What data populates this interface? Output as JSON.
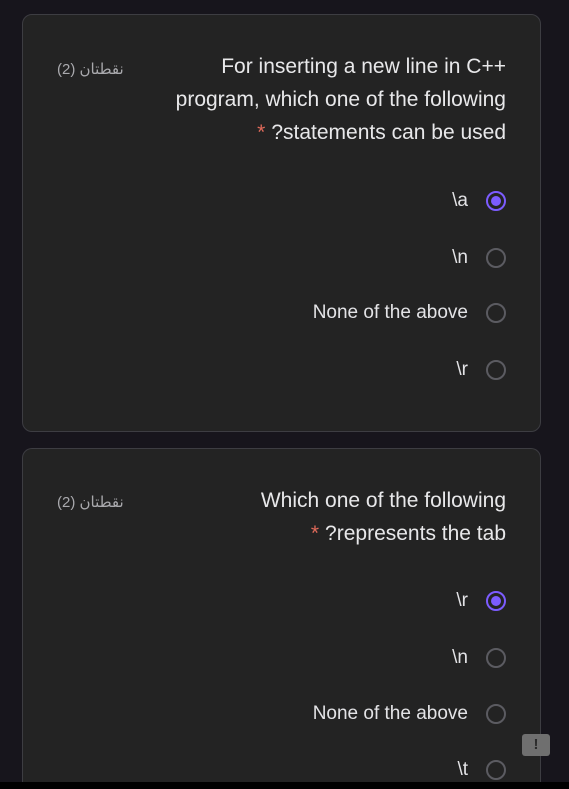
{
  "questions": [
    {
      "points": "نقطتان (2)",
      "lines": [
        "For inserting a new line in C++",
        "program, which one of the following",
        "?statements can be used"
      ],
      "required_mark": "*",
      "options": [
        {
          "label": "\\a",
          "checked": true
        },
        {
          "label": "\\n",
          "checked": false
        },
        {
          "label": "None of the above",
          "checked": false
        },
        {
          "label": "\\r",
          "checked": false
        }
      ]
    },
    {
      "points": "نقطتان (2)",
      "lines": [
        "Which one of the following",
        "?represents the tab"
      ],
      "required_mark": "*",
      "options": [
        {
          "label": "\\r",
          "checked": true
        },
        {
          "label": "\\n",
          "checked": false
        },
        {
          "label": "None of the above",
          "checked": false
        },
        {
          "label": "\\t",
          "checked": false
        }
      ]
    }
  ],
  "feedback_button": {
    "glyph": "!",
    "icon": "report-icon"
  },
  "colors": {
    "accent": "#7c5cff",
    "required": "#e06a5a",
    "card": "#232323",
    "background": "#17151c"
  }
}
